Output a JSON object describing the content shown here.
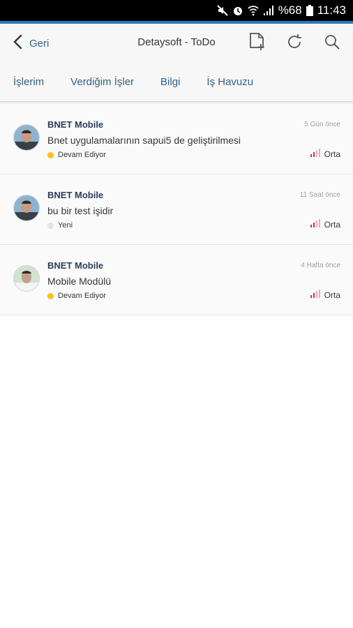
{
  "status_bar": {
    "battery_text": "%68",
    "time": "11:43",
    "icons": [
      "mute-icon",
      "alarm-icon",
      "wifi-icon",
      "signal-icon",
      "battery-icon"
    ]
  },
  "header": {
    "back_label": "Geri",
    "title": "Detaysoft - ToDo",
    "actions": [
      "new-document-icon",
      "refresh-icon",
      "search-icon"
    ]
  },
  "tabs": [
    {
      "label": "İşlerim"
    },
    {
      "label": "Verdiğim İşler"
    },
    {
      "label": "Bilgi"
    },
    {
      "label": "İş Havuzu"
    }
  ],
  "tasks": [
    {
      "owner": "BNET Mobile",
      "time": "5 Gün önce",
      "description": "Bnet uygulamalarının sapui5 de geliştirilmesi",
      "status": "Devam Ediyor",
      "status_color": "#f5c518",
      "priority": "Orta",
      "priority_color": "#c0306a"
    },
    {
      "owner": "BNET Mobile",
      "time": "11 Saat önce",
      "description": "bu bir test işidir",
      "status": "Yeni",
      "status_color": "#e3e3e3",
      "priority": "Orta",
      "priority_color": "#c0306a"
    },
    {
      "owner": "BNET Mobile",
      "time": "4 Hafta önce",
      "description": "Mobile Modülü",
      "status": "Devam Ediyor",
      "status_color": "#f5c518",
      "priority": "Orta",
      "priority_color": "#c0306a"
    }
  ]
}
